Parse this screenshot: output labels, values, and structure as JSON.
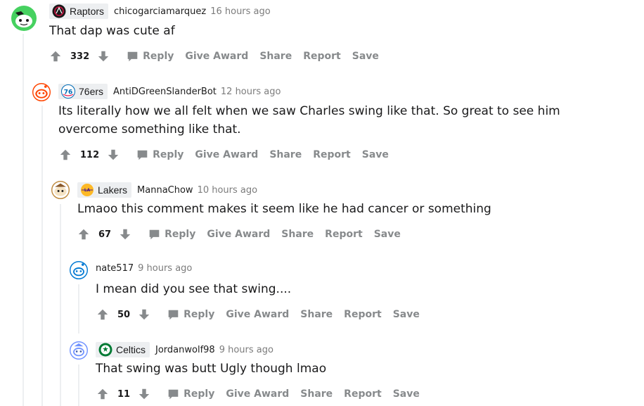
{
  "actions": {
    "reply": "Reply",
    "give_award": "Give Award",
    "share": "Share",
    "report": "Report",
    "save": "Save"
  },
  "comments": [
    {
      "flair": "Raptors",
      "username": "chicogarciamarquez",
      "time": "16 hours ago",
      "text": "That dap was cute af",
      "score": "332",
      "avatar_color": "#46d160",
      "flair_icon": "raptors-logo-icon"
    },
    {
      "flair": "76ers",
      "username": "AntiDGreenSlanderBot",
      "time": "12 hours ago",
      "text": "Its literally how we all felt when we saw Charles swing like that. So great to see him overcome something like that.",
      "score": "112",
      "avatar_color": "#ff4500",
      "flair_icon": "76ers-logo-icon"
    },
    {
      "flair": "Lakers",
      "username": "MannaChow",
      "time": "10 hours ago",
      "text": "Lmaoo this comment makes it seem like he had cancer or something",
      "score": "67",
      "avatar_color": "#c18d42",
      "flair_icon": "lakers-logo-icon"
    },
    {
      "flair": "",
      "username": "nate517",
      "time": "9 hours ago",
      "text": "I mean did you see that swing....",
      "score": "50",
      "avatar_color": "#0079d3",
      "flair_icon": ""
    },
    {
      "flair": "Celtics",
      "username": "Jordanwolf98",
      "time": "9 hours ago",
      "text": "That swing was butt Ugly though lmao",
      "score": "11",
      "avatar_color": "#7193ff",
      "flair_icon": "celtics-logo-icon"
    }
  ]
}
